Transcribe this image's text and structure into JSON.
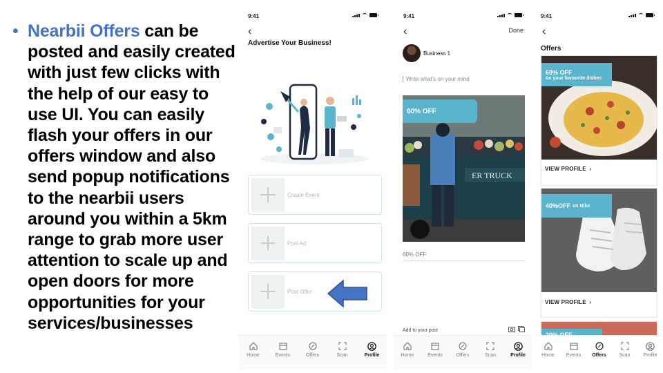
{
  "bullet": {
    "highlight": "Nearbii Offers",
    "text": " can be posted and easily created with just few clicks with the help of our easy to use UI. You can easily flash your offers in our offers window and also send popup notifications to the nearbii users around you within a 5km range to grab more user attention to scale up and open doors for more opportunities for your services/businesses"
  },
  "status_time": "9:41",
  "tabs": [
    {
      "label": "Home",
      "icon": "home-icon"
    },
    {
      "label": "Events",
      "icon": "calendar-icon"
    },
    {
      "label": "Offers",
      "icon": "offers-icon"
    },
    {
      "label": "Scan",
      "icon": "scan-icon"
    },
    {
      "label": "Profile",
      "icon": "profile-icon"
    }
  ],
  "screen1": {
    "title": "Advertise Your Business!",
    "actions": [
      "Create Event",
      "Post Ad",
      "Post Offer"
    ],
    "active_tab": "Profile"
  },
  "screen2": {
    "done": "Done",
    "business": "Business 1",
    "placeholder": "Write what's on your mind",
    "badge": "60% OFF",
    "caption": "60% OFF",
    "add_to_post": "Add to your post",
    "active_tab": "Profile"
  },
  "screen3": {
    "title": "Offers",
    "cards": [
      {
        "badge_main": "60% OFF",
        "badge_sub": "on your favourite dishes",
        "action": "VIEW PROFILE"
      },
      {
        "badge_main": "40%OFF",
        "badge_sub": "on Nike",
        "action": "VIEW PROFILE"
      },
      {
        "badge_main": "20% OFF",
        "badge_sub": ""
      }
    ],
    "active_tab": "Offers"
  },
  "colors": {
    "accent": "#5ab4cc",
    "highlight": "#4472c4",
    "arrow": "#4472c4"
  }
}
